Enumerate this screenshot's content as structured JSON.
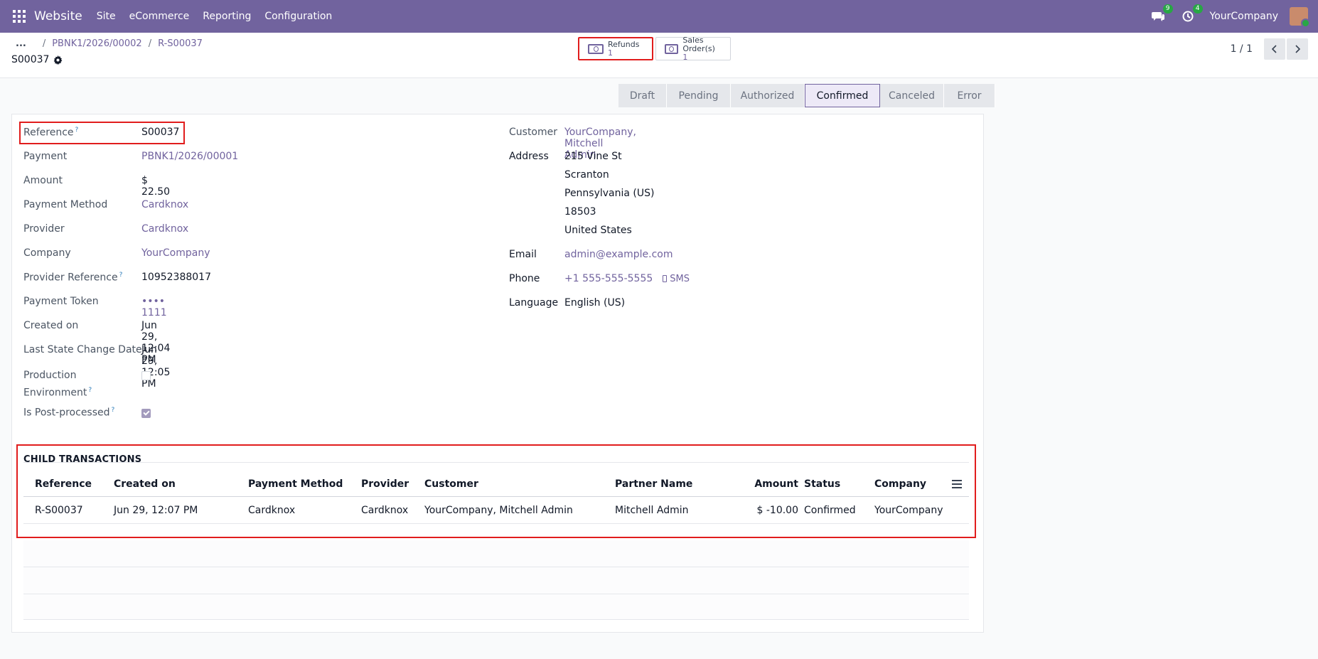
{
  "navbar": {
    "brand": "Website",
    "menu": [
      "Site",
      "eCommerce",
      "Reporting",
      "Configuration"
    ],
    "messages_count": "9",
    "activities_count": "4",
    "company": "YourCompany"
  },
  "breadcrumb": {
    "ellipsis": "...",
    "items": [
      "PBNK1/2026/00002",
      "R-S00037"
    ]
  },
  "record": {
    "title": "S00037"
  },
  "smart_buttons": [
    {
      "label": "Refunds",
      "value": "1"
    },
    {
      "label": "Sales Order(s)",
      "value": "1"
    }
  ],
  "pager": {
    "value": "1 / 1"
  },
  "statusbar": {
    "stages": [
      "Draft",
      "Pending",
      "Authorized",
      "Confirmed",
      "Canceled",
      "Error"
    ],
    "active": "Confirmed"
  },
  "left_fields": {
    "reference": {
      "label": "Reference",
      "value": "S00037"
    },
    "payment": {
      "label": "Payment",
      "value": "PBNK1/2026/00001"
    },
    "amount": {
      "label": "Amount",
      "value": "$ 22.50"
    },
    "payment_method": {
      "label": "Payment Method",
      "value": "Cardknox"
    },
    "provider": {
      "label": "Provider",
      "value": "Cardknox"
    },
    "company": {
      "label": "Company",
      "value": "YourCompany"
    },
    "provider_reference": {
      "label": "Provider Reference",
      "value": "10952388017"
    },
    "payment_token": {
      "label": "Payment Token",
      "value": "•••• 1111"
    },
    "created_on": {
      "label": "Created on",
      "value": "Jun 29, 12:04 PM"
    },
    "last_state_change": {
      "label": "Last State Change Date",
      "value": "Jun 29, 12:05 PM"
    },
    "production_env": {
      "label_line1": "Production",
      "label_line2": "Environment",
      "checked": false
    },
    "is_post_processed": {
      "label": "Is Post-processed",
      "checked": true
    }
  },
  "right_fields": {
    "customer": {
      "label": "Customer",
      "value": "YourCompany, Mitchell Admin"
    },
    "address": {
      "label": "Address",
      "lines": [
        "215 Vine St",
        "Scranton",
        "Pennsylvania (US)",
        "18503",
        "United States"
      ]
    },
    "email": {
      "label": "Email",
      "value": "admin@example.com"
    },
    "phone": {
      "label": "Phone",
      "value": "+1 555-555-5555",
      "sms": "SMS"
    },
    "language": {
      "label": "Language",
      "value": "English (US)"
    }
  },
  "child_transactions": {
    "title": "CHILD TRANSACTIONS",
    "columns": [
      "Reference",
      "Created on",
      "Payment Method",
      "Provider",
      "Customer",
      "Partner Name",
      "Amount",
      "Status",
      "Company"
    ],
    "rows": [
      [
        "R-S00037",
        "Jun 29, 12:07 PM",
        "Cardknox",
        "Cardknox",
        "YourCompany, Mitchell Admin",
        "Mitchell Admin",
        "$ -10.00",
        "Confirmed",
        "YourCompany"
      ]
    ]
  },
  "colors": {
    "navbar": "#71639e",
    "accent": "#71639e",
    "highlight": "#e11d1d"
  }
}
